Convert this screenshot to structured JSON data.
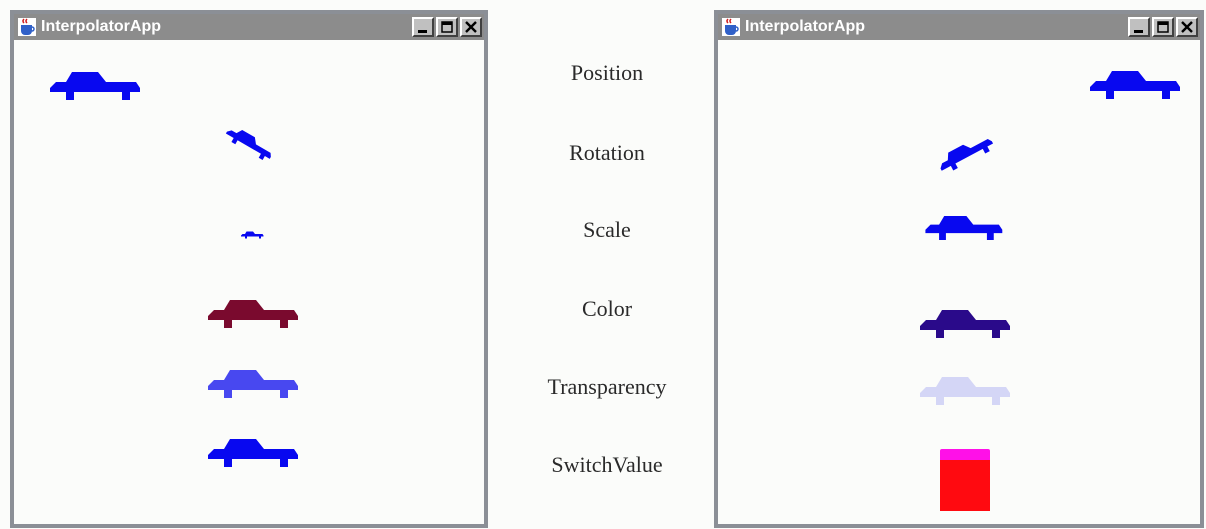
{
  "windows": {
    "left": {
      "title": "InterpolatorApp"
    },
    "right": {
      "title": "InterpolatorApp"
    }
  },
  "labels": [
    "Position",
    "Rotation",
    "Scale",
    "Color",
    "Transparency",
    "SwitchValue"
  ],
  "colors": {
    "car_blue": "#0808f0",
    "car_color_left": "#7a0a2e",
    "car_color_right": "#2a0a8a",
    "car_transparent_left": "#4848f0",
    "car_transparent_right": "#d4d6f6",
    "switch_top": "#ff10e8",
    "switch_bottom": "#ff0a10"
  },
  "icons": [
    "java-app-icon",
    "minimize-icon",
    "maximize-icon",
    "close-icon"
  ]
}
